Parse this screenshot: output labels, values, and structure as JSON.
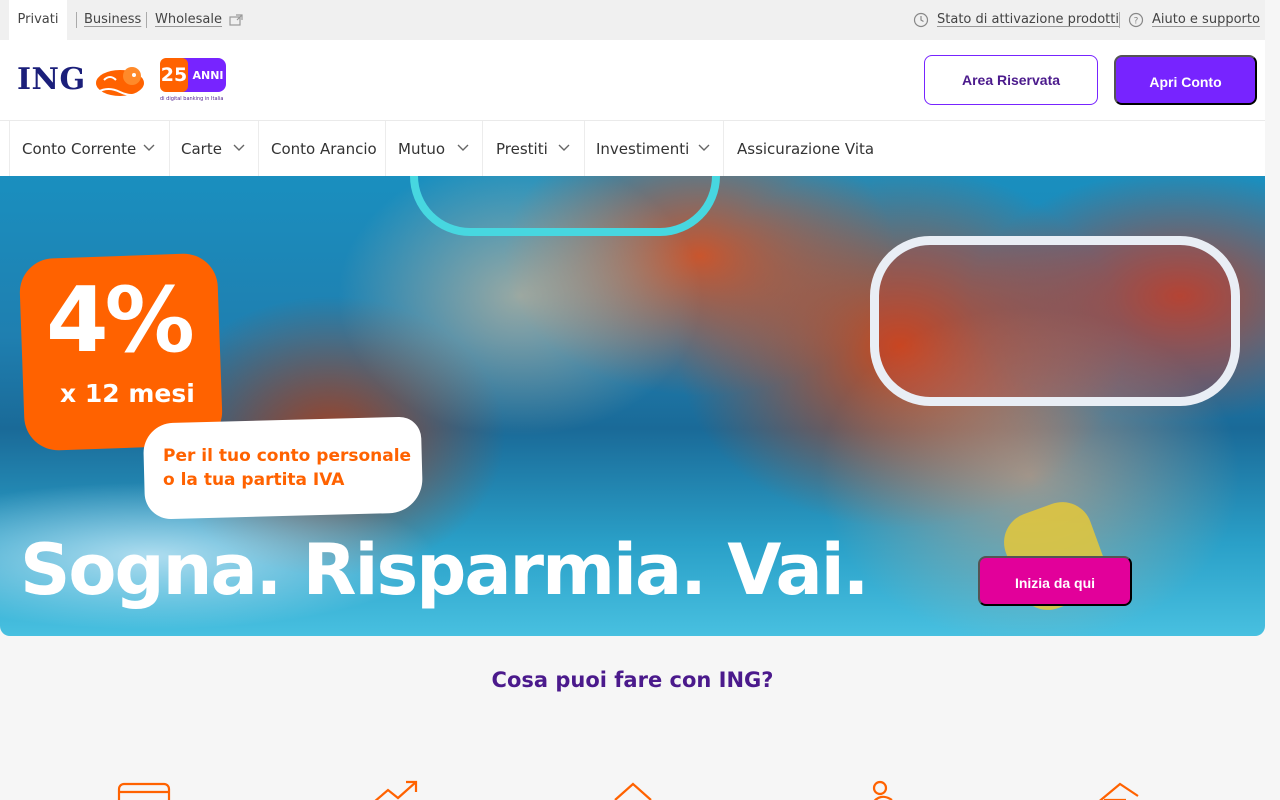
{
  "topbar": {
    "segments": [
      "Privati",
      "Business",
      "Wholesale"
    ],
    "util_links": [
      "Stato di attivazione prodotti",
      "Aiuto e supporto"
    ]
  },
  "header": {
    "logo_text": "ING",
    "anniversary_number": "25",
    "anniversary_word": "ANNI",
    "anniversary_tagline": "di digital banking in Italia",
    "login_label": "Area Riservata",
    "open_account_label": "Apri Conto"
  },
  "nav": {
    "items": [
      "Conto Corrente",
      "Carte",
      "Conto Arancio",
      "Mutuo",
      "Prestiti",
      "Investimenti",
      "Assicurazione Vita"
    ]
  },
  "hero": {
    "rate": "4%",
    "months": "x 12 mesi",
    "bubble_line1": "Per il tuo conto personale",
    "bubble_line2": "o la tua partita IVA",
    "headline": "Sogna. Risparmia. Vai.",
    "cta": "Inizia da qui"
  },
  "section": {
    "title": "Cosa puoi fare con ING?",
    "icons": [
      "card-icon",
      "trend-up-icon",
      "house-icon",
      "piggy-icon",
      "wallet-icon"
    ]
  },
  "colors": {
    "brand_orange": "#ff6200",
    "accent_purple": "#7724ff",
    "cta_magenta": "#e2009a",
    "title_purple": "#4b1a8c"
  }
}
